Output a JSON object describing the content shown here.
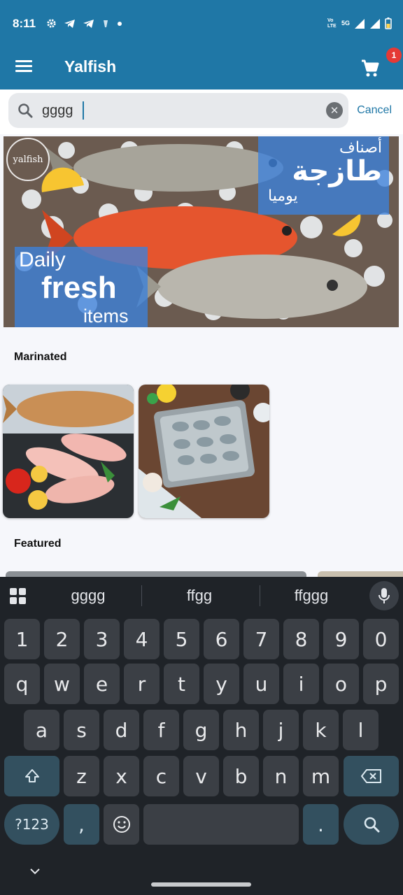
{
  "status_bar": {
    "time": "8:11",
    "network": "5G",
    "volte": "Vo LTE"
  },
  "app_bar": {
    "title": "Yalfish",
    "cart_badge_count": "1"
  },
  "search": {
    "value": "gggg",
    "cancel_label": "Cancel"
  },
  "banner": {
    "logo_text": "yalfish",
    "arabic_line1": "أصناف",
    "arabic_line2": "طازجة",
    "arabic_line3": "يوميا",
    "english_line1": "Daily",
    "english_line2": "fresh",
    "english_line3": "items"
  },
  "sections": {
    "marinated_title": "Marinated",
    "featured_title": "Featured"
  },
  "keyboard": {
    "suggestions": [
      "gggg",
      "ffgg",
      "ffggg"
    ],
    "row_numbers": [
      "1",
      "2",
      "3",
      "4",
      "5",
      "6",
      "7",
      "8",
      "9",
      "0"
    ],
    "row_top": [
      "q",
      "w",
      "e",
      "r",
      "t",
      "y",
      "u",
      "i",
      "o",
      "p"
    ],
    "row_mid": [
      "a",
      "s",
      "d",
      "f",
      "g",
      "h",
      "j",
      "k",
      "l"
    ],
    "row_bottom": [
      "z",
      "x",
      "c",
      "v",
      "b",
      "n",
      "m"
    ],
    "symbols_label": "?123",
    "comma_label": ",",
    "period_label": "."
  },
  "colors": {
    "primary": "#1f77a6",
    "badge": "#e53935",
    "keyboard_bg": "#1f2328",
    "key_bg": "#3b3f45",
    "mod_key_bg": "#33505f"
  }
}
